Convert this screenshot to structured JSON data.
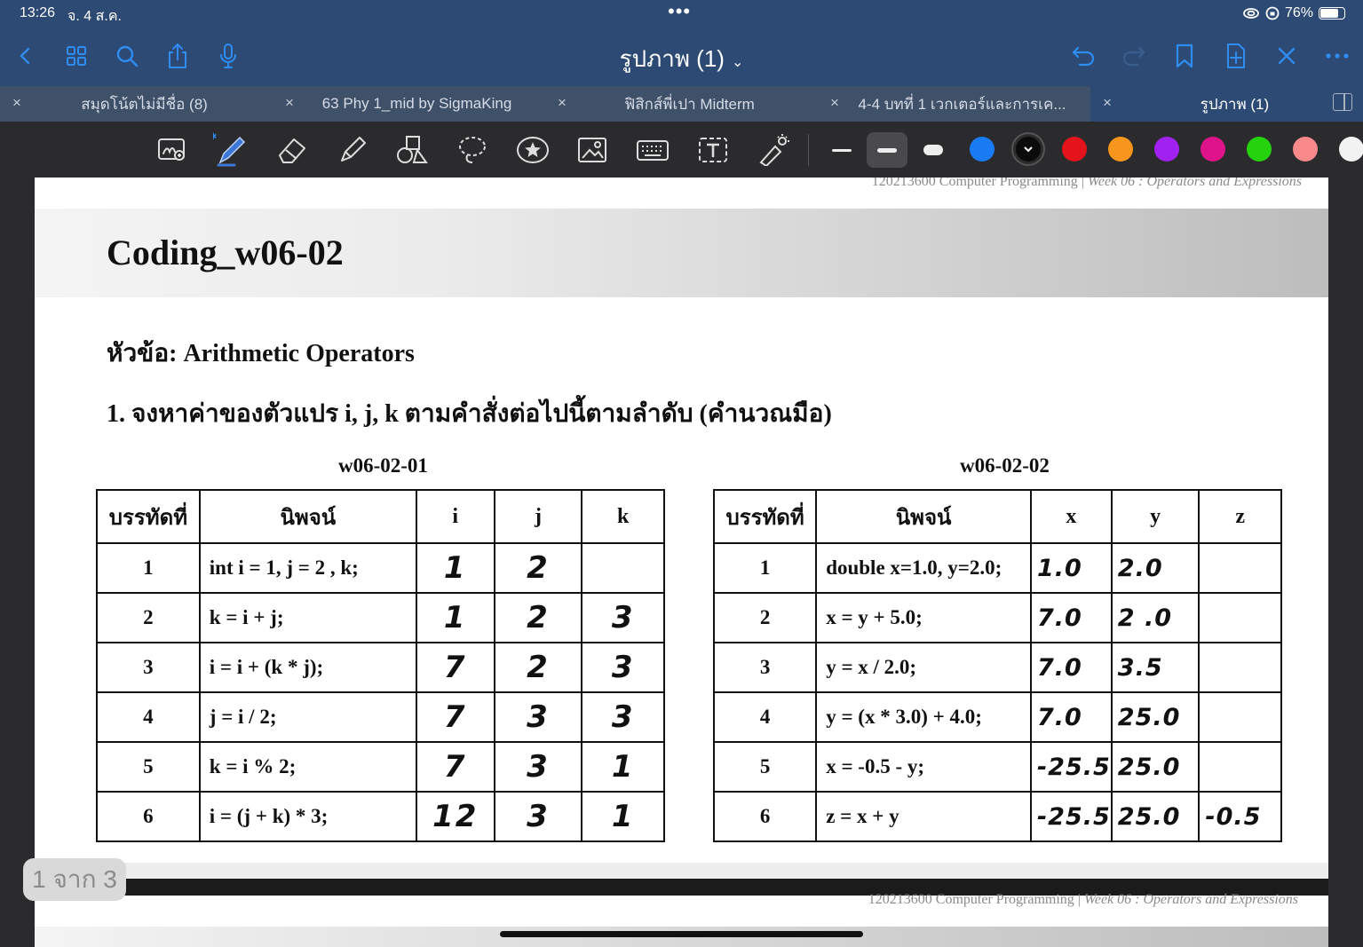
{
  "status": {
    "time": "13:26",
    "date": "จ. 4 ส.ค.",
    "battery": "76%",
    "dots": "•••"
  },
  "nav": {
    "title": "รูปภาพ (1)",
    "chevron": "⌄"
  },
  "tabs": [
    {
      "label": "สมุดโน้ตไม่มีชื่อ (8)",
      "close": "×"
    },
    {
      "label": "63 Phy 1_mid by SigmaKing",
      "close": "×"
    },
    {
      "label": "ฟิสิกส์พี่เปา Midterm",
      "close": "×"
    },
    {
      "label": "4-4 บทที่ 1 เวกเตอร์และการเค...",
      "close": "×"
    },
    {
      "label": "รูปภาพ (1)",
      "close": "×"
    }
  ],
  "colors": {
    "nav_bg": "#2c4a74",
    "tab_bg": "#3f5069",
    "toolbar_bg": "#2b2b2d",
    "swatches": [
      "#1a7cf5",
      "#0b0b0b",
      "#e3141b",
      "#f7961d",
      "#a121f0",
      "#e0148a",
      "#26d10e",
      "#f7898a"
    ]
  },
  "doc": {
    "header_left": "120213600 Computer Programming | ",
    "header_right": "Week 06 : Operators and Expressions",
    "banner_title": "Coding_w06-02",
    "subject": "หัวข้อ: Arithmetic Operators",
    "question": "1. จงหาค่าของตัวแปร i, j, k ตามคำสั่งต่อไปนี้ตามลำดับ (คำนวณมือ)",
    "table1": {
      "caption": "w06-02-01",
      "headers": [
        "บรรทัดที่",
        "นิพจน์",
        "i",
        "j",
        "k"
      ],
      "rows": [
        [
          "1",
          "int i = 1, j = 2 , k;",
          "1",
          "2",
          ""
        ],
        [
          "2",
          "k = i + j;",
          "1",
          "2",
          "3"
        ],
        [
          "3",
          "i = i + (k * j);",
          "7",
          "2",
          "3"
        ],
        [
          "4",
          "j = i / 2;",
          "7",
          "3",
          "3"
        ],
        [
          "5",
          "k = i % 2;",
          "7",
          "3",
          "1"
        ],
        [
          "6",
          "i = (j + k) * 3;",
          "12",
          "3",
          "1"
        ]
      ]
    },
    "table2": {
      "caption": "w06-02-02",
      "headers": [
        "บรรทัดที่",
        "นิพจน์",
        "x",
        "y",
        "z"
      ],
      "rows": [
        [
          "1",
          "double x=1.0, y=2.0;",
          "1.0",
          "2.0",
          ""
        ],
        [
          "2",
          "x = y + 5.0;",
          "7.0",
          "2 .0",
          ""
        ],
        [
          "3",
          "y = x / 2.0;",
          "7.0",
          "3.5",
          ""
        ],
        [
          "4",
          "y = (x * 3.0) + 4.0;",
          "7.0",
          "25.0",
          ""
        ],
        [
          "5",
          "x = -0.5 - y;",
          "-25.5",
          "25.0",
          ""
        ],
        [
          "6",
          "z = x + y",
          "-25.5",
          "25.0",
          "-0.5"
        ]
      ]
    }
  },
  "page_indicator": "1 จาก 3"
}
